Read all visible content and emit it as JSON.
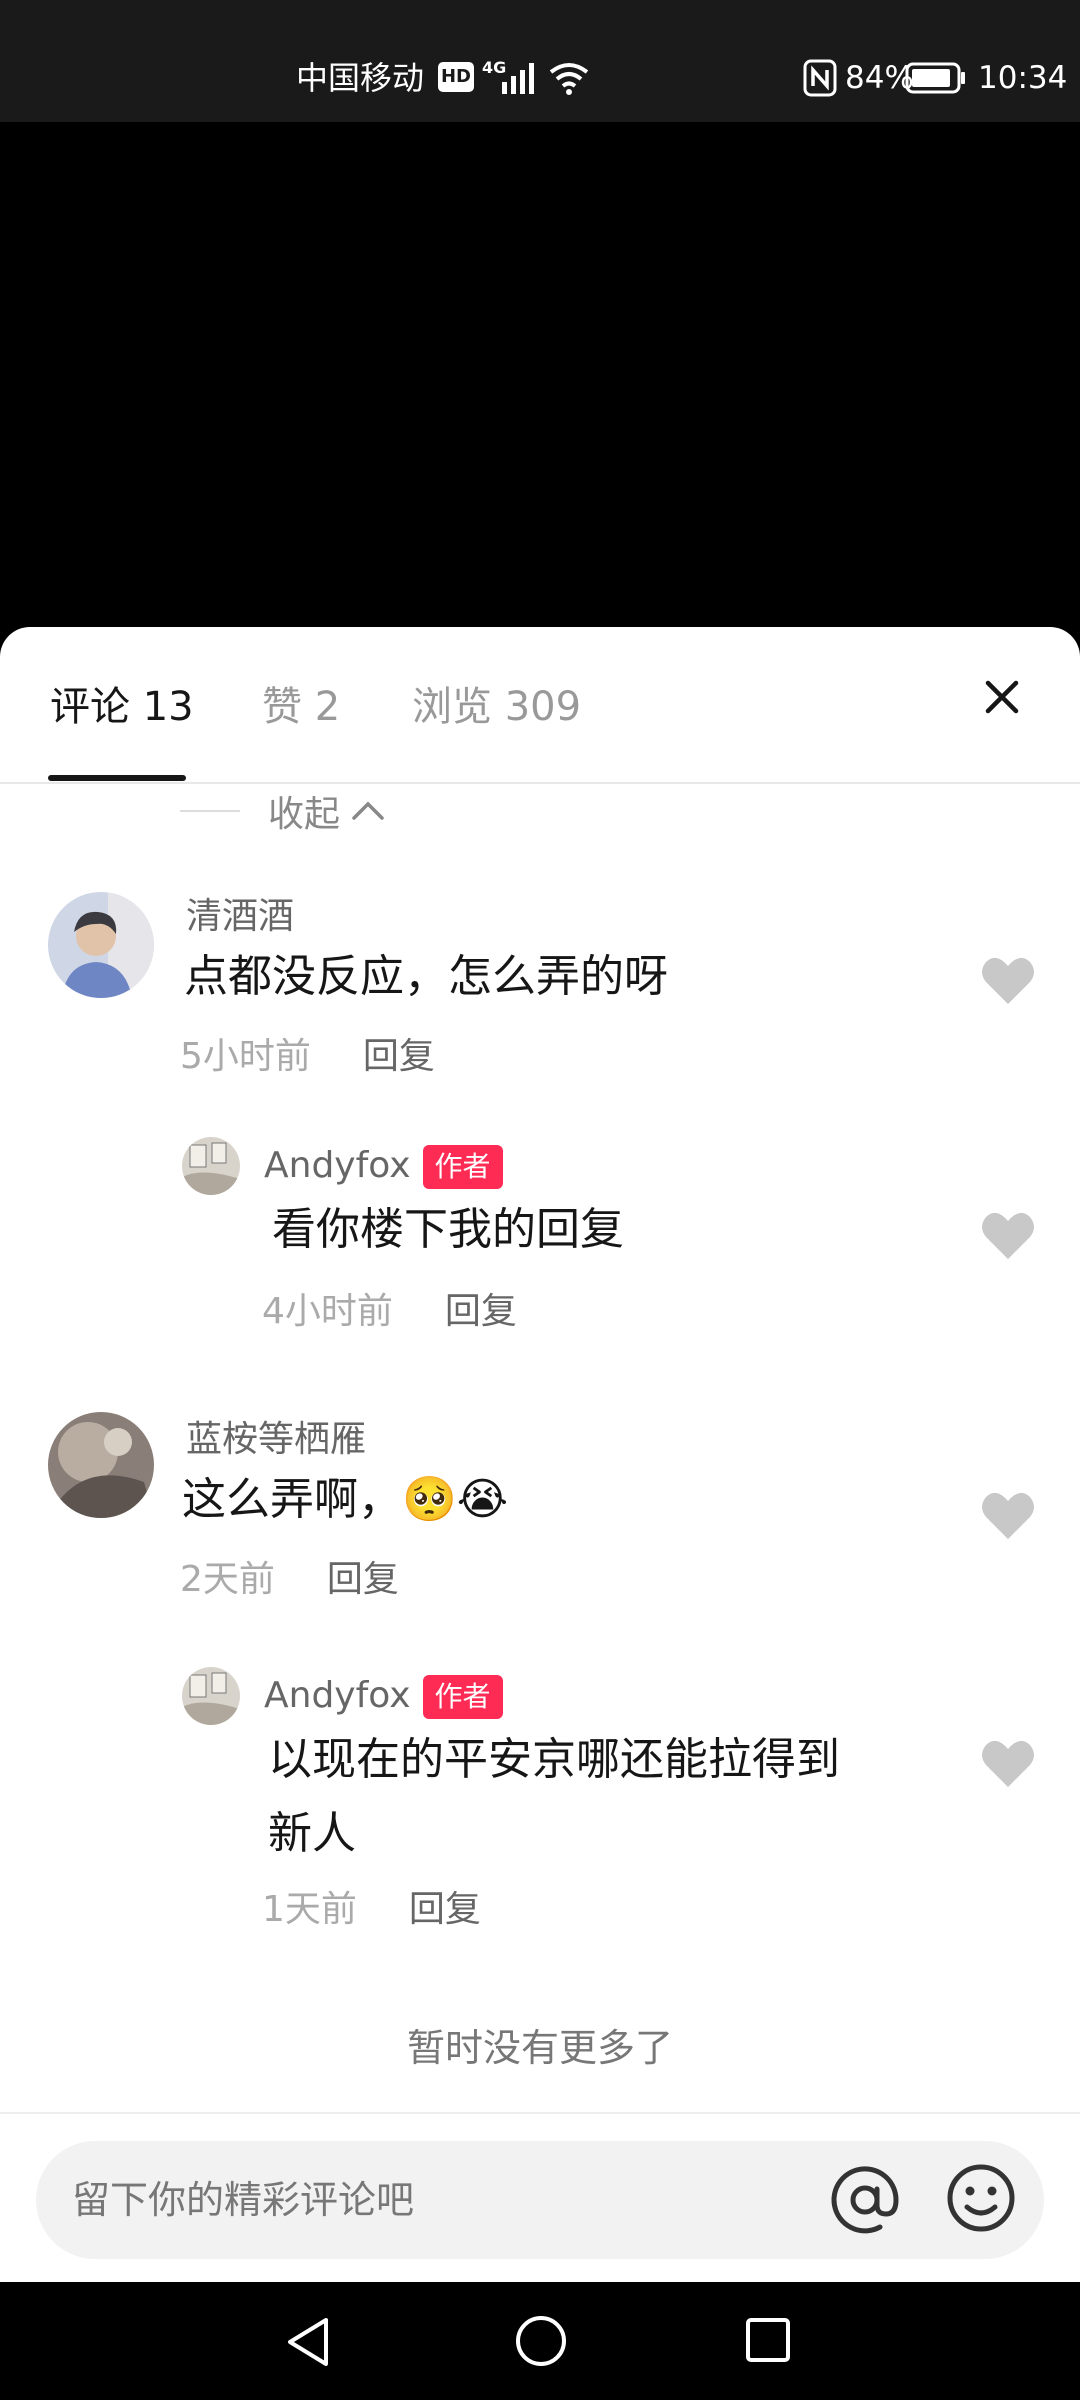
{
  "status_bar": {
    "carrier": "中国移动",
    "hd_badge": "HD",
    "network": "4G",
    "battery_percent": "84%",
    "time": "10:34"
  },
  "tabs": [
    {
      "label": "评论 13",
      "active": true
    },
    {
      "label": "赞 2",
      "active": false
    },
    {
      "label": "浏览 309",
      "active": false
    }
  ],
  "collapse_label": "收起",
  "comments": [
    {
      "name": "清酒酒",
      "text": "点都没反应，怎么弄的呀",
      "time": "5小时前",
      "reply": "回复",
      "replies": [
        {
          "name": "Andyfox",
          "badge": "作者",
          "text": "看你楼下我的回复",
          "time": "4小时前",
          "reply": "回复"
        }
      ]
    },
    {
      "name": "蓝桉等栖雁",
      "text": "这么弄啊，",
      "emojis": "🥺😭",
      "time": "2天前",
      "reply": "回复",
      "replies": [
        {
          "name": "Andyfox",
          "badge": "作者",
          "text_line1": "以现在的平安京哪还能拉得到",
          "text_line2": "新人",
          "time": "1天前",
          "reply": "回复"
        }
      ]
    }
  ],
  "no_more": "暂时没有更多了",
  "input": {
    "placeholder": "留下你的精彩评论吧"
  },
  "colors": {
    "accent_badge": "#fe2c55",
    "like_icon": "#c8c8c8"
  }
}
